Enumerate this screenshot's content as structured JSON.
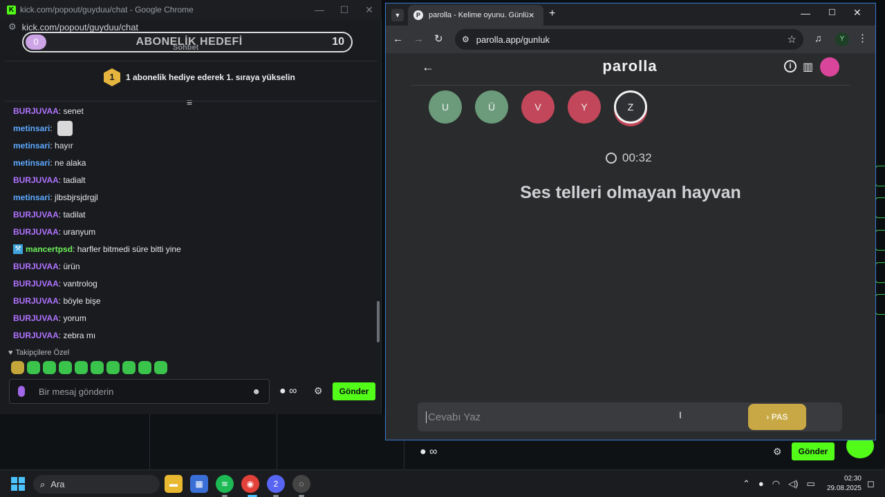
{
  "kick": {
    "window_title": "kick.com/popout/guyduu/chat - Google Chrome",
    "url": "kick.com/popout/guyduu/chat",
    "goal": {
      "current": "0",
      "title": "ABONELİK HEDEFİ",
      "target": "10"
    },
    "tab_label": "Sohbet",
    "gift_rank": "1",
    "gift_text": "1 abonelik hediye ederek 1. sıraya yükselin",
    "messages": [
      {
        "user": "BURJUVAA",
        "color": "#b173ff",
        "text": "senet"
      },
      {
        "user": "metinsari",
        "color": "#5ea9ff",
        "text": ""
      },
      {
        "user": "metinsari",
        "color": "#5ea9ff",
        "text": "hayır"
      },
      {
        "user": "metinsari",
        "color": "#5ea9ff",
        "text": "ne alaka"
      },
      {
        "user": "BURJUVAA",
        "color": "#b173ff",
        "text": "tadialt"
      },
      {
        "user": "metinsari",
        "color": "#5ea9ff",
        "text": "jlbsbjrsjdrgjl"
      },
      {
        "user": "BURJUVAA",
        "color": "#b173ff",
        "text": "tadilat"
      },
      {
        "user": "BURJUVAA",
        "color": "#b173ff",
        "text": "uranyum"
      },
      {
        "user": "mancertpsd",
        "color": "#6ff05a",
        "text": "harfler bitmedi süre bitti yine"
      },
      {
        "user": "BURJUVAA",
        "color": "#b173ff",
        "text": "ürün"
      },
      {
        "user": "BURJUVAA",
        "color": "#b173ff",
        "text": "vantrolog"
      },
      {
        "user": "BURJUVAA",
        "color": "#b173ff",
        "text": "böyle bişe"
      },
      {
        "user": "BURJUVAA",
        "color": "#b173ff",
        "text": "yorum"
      },
      {
        "user": "BURJUVAA",
        "color": "#b173ff",
        "text": "zebra mı"
      }
    ],
    "followers_label": "Takipçilere Özel",
    "input_placeholder": "Bir mesaj gönderin",
    "send_label": "Gönder"
  },
  "parolla": {
    "tab_title": "parolla - Kelime oyunu. Günlük",
    "url": "parolla.app/gunluk",
    "profile_initial": "Y",
    "site_title": "parolla",
    "letters": [
      {
        "char": "U",
        "state": "correct"
      },
      {
        "char": "Ü",
        "state": "correct"
      },
      {
        "char": "V",
        "state": "wrong"
      },
      {
        "char": "Y",
        "state": "wrong"
      },
      {
        "char": "Z",
        "state": "current"
      }
    ],
    "timer": "00:32",
    "question": "Ses telleri olmayan hayvan",
    "answer_placeholder": "Cevabı Yaz",
    "pass_label": "PAS"
  },
  "background": {
    "send_label": "Gönder"
  },
  "taskbar": {
    "search_label": "Ara",
    "time": "02:30",
    "date": "29.08.2025",
    "discord_badge": "2"
  },
  "colors": {
    "kick_green": "#53fc18",
    "correct": "#6b9b7a",
    "wrong": "#c2475a",
    "pass": "#c8a844"
  }
}
